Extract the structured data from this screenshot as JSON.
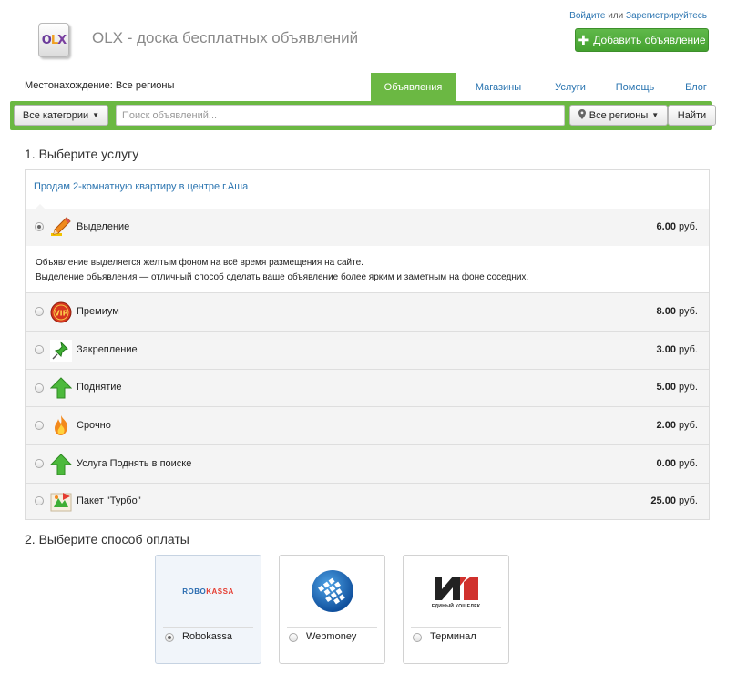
{
  "header": {
    "logo_text": [
      "O",
      "L",
      "X"
    ],
    "site_title": "OLX - доска бесплатных объявлений",
    "login_link": "Войдите",
    "or_text": "или",
    "register_link": "Зарегистрируйтесь",
    "add_button": "Добавить объявление"
  },
  "location": "Местонахождение: Все регионы",
  "tabs": [
    {
      "label": "Объявления",
      "active": true
    },
    {
      "label": "Магазины"
    },
    {
      "label": "Услуги"
    },
    {
      "label": "Помощь"
    },
    {
      "label": "Блог"
    }
  ],
  "search": {
    "category_button": "Все категории",
    "placeholder": "Поиск объявлений...",
    "region_button": "Все регионы",
    "submit": "Найти"
  },
  "step1_title": "1. Выберите услугу",
  "ad_title": "Продам 2-комнатную квартиру в центре г.Аша",
  "services": [
    {
      "label": "Выделение",
      "price": "6.00",
      "currency": "руб.",
      "icon": "pencil-icon",
      "checked": true
    },
    {
      "label": "Премиум",
      "price": "8.00",
      "currency": "руб.",
      "icon": "vip-icon"
    },
    {
      "label": "Закрепление",
      "price": "3.00",
      "currency": "руб.",
      "icon": "pin-icon"
    },
    {
      "label": "Поднятие",
      "price": "5.00",
      "currency": "руб.",
      "icon": "arrow-up-icon"
    },
    {
      "label": "Срочно",
      "price": "2.00",
      "currency": "руб.",
      "icon": "fire-icon"
    },
    {
      "label": "Услуга Поднять в поиске",
      "price": "0.00",
      "currency": "руб.",
      "icon": "arrow-up-icon"
    },
    {
      "label": "Пакет \"Турбо\"",
      "price": "25.00",
      "currency": "руб.",
      "icon": "turbo-package-icon"
    }
  ],
  "service_description": [
    "Объявление выделяется желтым фоном на всё время размещения на сайте.",
    "Выделение объявления — отличный способ сделать ваше объявление более ярким и заметным на фоне соседних."
  ],
  "step2_title": "2. Выберите способ оплаты",
  "payments": [
    {
      "name": "Robokassa",
      "logo_text_a": "ROBO",
      "logo_text_b": "KASSA",
      "checked": true
    },
    {
      "name": "Webmoney"
    },
    {
      "name": "Терминал",
      "logo_caption": "ЕДИНЫЙ КОШЕЛЕК"
    }
  ],
  "colors": {
    "accent_green": "#6bb843",
    "link_blue": "#2a74b0"
  }
}
